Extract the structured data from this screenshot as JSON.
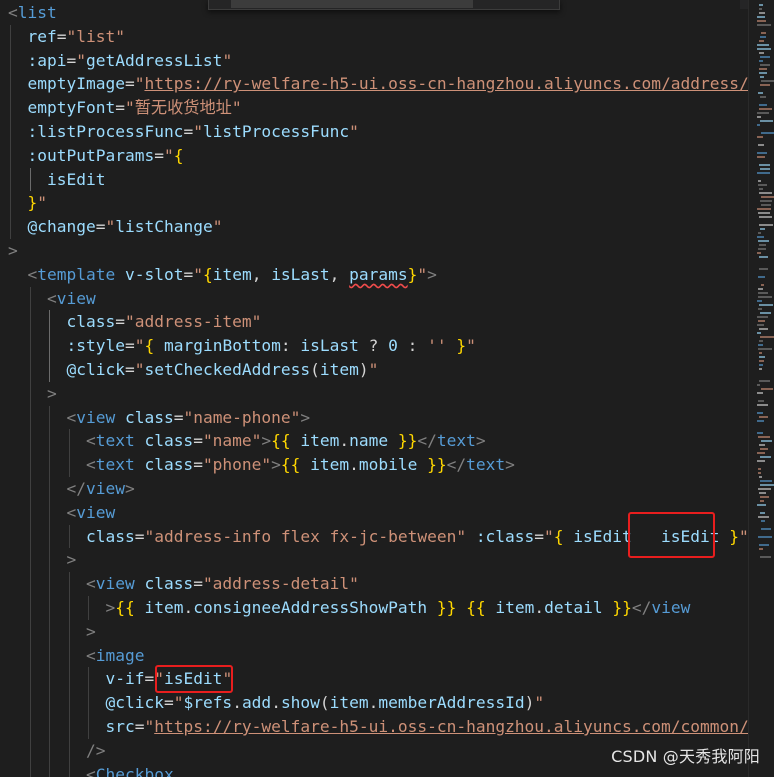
{
  "editor": {
    "language": "vue",
    "theme": "dark",
    "highlighted_tokens": [
      "isEdit",
      "isEdit"
    ],
    "lines": [
      [
        [
          "tok-bracket",
          "<"
        ],
        [
          "tok-tag",
          "list"
        ]
      ],
      [
        [
          "",
          "  "
        ],
        [
          "tok-attr",
          "ref"
        ],
        [
          "",
          "="
        ],
        [
          "tok-str",
          "\"list\""
        ]
      ],
      [
        [
          "",
          "  "
        ],
        [
          "tok-attr",
          ":api"
        ],
        [
          "",
          "="
        ],
        [
          "tok-str",
          "\""
        ],
        [
          "tok-var",
          "getAddressList"
        ],
        [
          "tok-str",
          "\""
        ]
      ],
      [
        [
          "",
          "  "
        ],
        [
          "tok-attr",
          "emptyImage"
        ],
        [
          "",
          "="
        ],
        [
          "tok-str",
          "\""
        ],
        [
          "tok-link",
          "https://ry-welfare-h5-ui.oss-cn-hangzhou.aliyuncs.com/address/e"
        ]
      ],
      [
        [
          "",
          "  "
        ],
        [
          "tok-attr",
          "emptyFont"
        ],
        [
          "",
          "="
        ],
        [
          "tok-str",
          "\"暂无收货地址\""
        ]
      ],
      [
        [
          "",
          "  "
        ],
        [
          "tok-attr",
          ":listProcessFunc"
        ],
        [
          "",
          "="
        ],
        [
          "tok-str",
          "\""
        ],
        [
          "tok-var",
          "listProcessFunc"
        ],
        [
          "tok-str",
          "\""
        ]
      ],
      [
        [
          "",
          "  "
        ],
        [
          "tok-attr",
          ":outPutParams"
        ],
        [
          "",
          "="
        ],
        [
          "tok-str",
          "\""
        ],
        [
          "tok-brace",
          "{"
        ]
      ],
      [
        [
          "",
          "    "
        ],
        [
          "tok-var",
          "isEdit"
        ]
      ],
      [
        [
          "",
          "  "
        ],
        [
          "tok-brace",
          "}"
        ],
        [
          "tok-str",
          "\""
        ]
      ],
      [
        [
          "",
          "  "
        ],
        [
          "tok-attr",
          "@change"
        ],
        [
          "",
          "="
        ],
        [
          "tok-str",
          "\""
        ],
        [
          "tok-var",
          "listChange"
        ],
        [
          "tok-str",
          "\""
        ]
      ],
      [
        [
          "tok-bracket",
          ">"
        ]
      ],
      [
        [
          "",
          "  "
        ],
        [
          "tok-bracket",
          "<"
        ],
        [
          "tok-tag",
          "template"
        ],
        [
          "",
          ""
        ],
        [
          "",
          " "
        ],
        [
          "tok-attr",
          "v-slot"
        ],
        [
          "",
          "="
        ],
        [
          "tok-str",
          "\""
        ],
        [
          "tok-brace",
          "{"
        ],
        [
          "tok-var",
          "item"
        ],
        [
          "",
          ", "
        ],
        [
          "tok-var",
          "isLast"
        ],
        [
          "",
          ", "
        ],
        [
          "tok-var squiggle",
          "params"
        ],
        [
          "tok-brace",
          "}"
        ],
        [
          "tok-str",
          "\""
        ],
        [
          "tok-bracket",
          ">"
        ]
      ],
      [
        [
          "",
          "    "
        ],
        [
          "tok-bracket",
          "<"
        ],
        [
          "tok-tag",
          "view"
        ]
      ],
      [
        [
          "",
          "      "
        ],
        [
          "tok-attr",
          "class"
        ],
        [
          "",
          "="
        ],
        [
          "tok-str",
          "\"address-item\""
        ]
      ],
      [
        [
          "",
          "      "
        ],
        [
          "tok-attr",
          ":style"
        ],
        [
          "",
          "="
        ],
        [
          "tok-str",
          "\""
        ],
        [
          "tok-brace",
          "{"
        ],
        [
          "",
          " "
        ],
        [
          "tok-var",
          "marginBottom"
        ],
        [
          "",
          ": "
        ],
        [
          "tok-var",
          "isLast"
        ],
        [
          "",
          " ? "
        ],
        [
          "tok-var",
          "0"
        ],
        [
          "",
          " : "
        ],
        [
          "tok-str",
          "''"
        ],
        [
          "",
          " "
        ],
        [
          "tok-brace",
          "}"
        ],
        [
          "tok-str",
          "\""
        ]
      ],
      [
        [
          "",
          "      "
        ],
        [
          "tok-attr",
          "@click"
        ],
        [
          "",
          "="
        ],
        [
          "tok-str",
          "\""
        ],
        [
          "tok-var",
          "setCheckedAddress"
        ],
        [
          "",
          "("
        ],
        [
          "tok-var",
          "item"
        ],
        [
          "",
          ")"
        ],
        [
          "tok-str",
          "\""
        ]
      ],
      [
        [
          "",
          "    "
        ],
        [
          "tok-bracket",
          ">"
        ]
      ],
      [
        [
          "",
          "      "
        ],
        [
          "tok-bracket",
          "<"
        ],
        [
          "tok-tag",
          "view"
        ],
        [
          "",
          " "
        ],
        [
          "tok-attr",
          "class"
        ],
        [
          "",
          "="
        ],
        [
          "tok-str",
          "\"name-phone\""
        ],
        [
          "tok-bracket",
          ">"
        ]
      ],
      [
        [
          "",
          "        "
        ],
        [
          "tok-bracket",
          "<"
        ],
        [
          "tok-tag",
          "text"
        ],
        [
          "",
          " "
        ],
        [
          "tok-attr",
          "class"
        ],
        [
          "",
          "="
        ],
        [
          "tok-str",
          "\"name\""
        ],
        [
          "tok-bracket",
          ">"
        ],
        [
          "tok-brace",
          "{{"
        ],
        [
          "",
          " "
        ],
        [
          "tok-var",
          "item"
        ],
        [
          "",
          "."
        ],
        [
          "tok-var",
          "name"
        ],
        [
          "",
          " "
        ],
        [
          "tok-brace",
          "}}"
        ],
        [
          "tok-bracket",
          "</"
        ],
        [
          "tok-tag",
          "text"
        ],
        [
          "tok-bracket",
          ">"
        ]
      ],
      [
        [
          "",
          "        "
        ],
        [
          "tok-bracket",
          "<"
        ],
        [
          "tok-tag",
          "text"
        ],
        [
          "",
          " "
        ],
        [
          "tok-attr",
          "class"
        ],
        [
          "",
          "="
        ],
        [
          "tok-str",
          "\"phone\""
        ],
        [
          "tok-bracket",
          ">"
        ],
        [
          "tok-brace",
          "{{"
        ],
        [
          "",
          " "
        ],
        [
          "tok-var",
          "item"
        ],
        [
          "",
          "."
        ],
        [
          "tok-var",
          "mobile"
        ],
        [
          "",
          " "
        ],
        [
          "tok-brace",
          "}}"
        ],
        [
          "tok-bracket",
          "</"
        ],
        [
          "tok-tag",
          "text"
        ],
        [
          "tok-bracket",
          ">"
        ]
      ],
      [
        [
          "",
          "      "
        ],
        [
          "tok-bracket",
          "</"
        ],
        [
          "tok-tag",
          "view"
        ],
        [
          "tok-bracket",
          ">"
        ]
      ],
      [
        [
          "",
          "      "
        ],
        [
          "tok-bracket",
          "<"
        ],
        [
          "tok-tag",
          "view"
        ]
      ],
      [
        [
          "",
          "        "
        ],
        [
          "tok-attr",
          "class"
        ],
        [
          "",
          "="
        ],
        [
          "tok-str",
          "\"address-info flex fx-jc-between\""
        ],
        [
          "",
          " "
        ],
        [
          "tok-attr",
          ":class"
        ],
        [
          "",
          "="
        ],
        [
          "tok-str",
          "\""
        ],
        [
          "tok-brace",
          "{"
        ],
        [
          "",
          " "
        ],
        [
          "tok-var",
          "isEdit"
        ],
        [
          "",
          " "
        ],
        [
          "",
          "  "
        ],
        [
          "tok-var",
          "isEdit"
        ],
        [
          "",
          " "
        ],
        [
          "tok-brace",
          "}"
        ],
        [
          "tok-str",
          "\""
        ]
      ],
      [
        [
          "",
          "      "
        ],
        [
          "tok-bracket",
          ">"
        ]
      ],
      [
        [
          "",
          "        "
        ],
        [
          "tok-bracket",
          "<"
        ],
        [
          "tok-tag",
          "view"
        ],
        [
          "",
          " "
        ],
        [
          "tok-attr",
          "class"
        ],
        [
          "",
          "="
        ],
        [
          "tok-str",
          "\"address-detail\""
        ]
      ],
      [
        [
          "",
          "          "
        ],
        [
          "tok-bracket",
          ">"
        ],
        [
          "tok-brace",
          "{{"
        ],
        [
          "",
          " "
        ],
        [
          "tok-var",
          "item"
        ],
        [
          "",
          "."
        ],
        [
          "tok-var",
          "consigneeAddressShowPath"
        ],
        [
          "",
          " "
        ],
        [
          "tok-brace",
          "}}"
        ],
        [
          "",
          " "
        ],
        [
          "tok-brace",
          "{{"
        ],
        [
          "",
          " "
        ],
        [
          "tok-var",
          "item"
        ],
        [
          "",
          "."
        ],
        [
          "tok-var",
          "detail"
        ],
        [
          "",
          " "
        ],
        [
          "tok-brace",
          "}}"
        ],
        [
          "tok-bracket",
          "</"
        ],
        [
          "tok-tag",
          "view"
        ]
      ],
      [
        [
          "",
          "        "
        ],
        [
          "tok-bracket",
          ">"
        ]
      ],
      [
        [
          "",
          "        "
        ],
        [
          "tok-bracket",
          "<"
        ],
        [
          "tok-tag",
          "image"
        ]
      ],
      [
        [
          "",
          "          "
        ],
        [
          "tok-attr",
          "v-if"
        ],
        [
          "",
          "="
        ],
        [
          "tok-str",
          "\""
        ],
        [
          "tok-var",
          "isEdit"
        ],
        [
          "tok-str",
          "\""
        ]
      ],
      [
        [
          "",
          "          "
        ],
        [
          "tok-attr",
          "@click"
        ],
        [
          "",
          "="
        ],
        [
          "tok-str",
          "\""
        ],
        [
          "tok-var",
          "$refs"
        ],
        [
          "",
          "."
        ],
        [
          "tok-var",
          "add"
        ],
        [
          "",
          "."
        ],
        [
          "tok-var",
          "show"
        ],
        [
          "",
          "("
        ],
        [
          "tok-var",
          "item"
        ],
        [
          "",
          "."
        ],
        [
          "tok-var",
          "memberAddressId"
        ],
        [
          "",
          ")"
        ],
        [
          "tok-str",
          "\""
        ]
      ],
      [
        [
          "",
          "          "
        ],
        [
          "tok-attr",
          "src"
        ],
        [
          "",
          "="
        ],
        [
          "tok-str",
          "\""
        ],
        [
          "tok-link",
          "https://ry-welfare-h5-ui.oss-cn-hangzhou.aliyuncs.com/common/e"
        ]
      ],
      [
        [
          "",
          "        "
        ],
        [
          "tok-bracket",
          "/>"
        ]
      ],
      [
        [
          "",
          "        "
        ],
        [
          "tok-bracket",
          "<"
        ],
        [
          "tok-tag",
          "Checkbox"
        ]
      ]
    ]
  },
  "watermark": "CSDN @天秀我阿阳"
}
